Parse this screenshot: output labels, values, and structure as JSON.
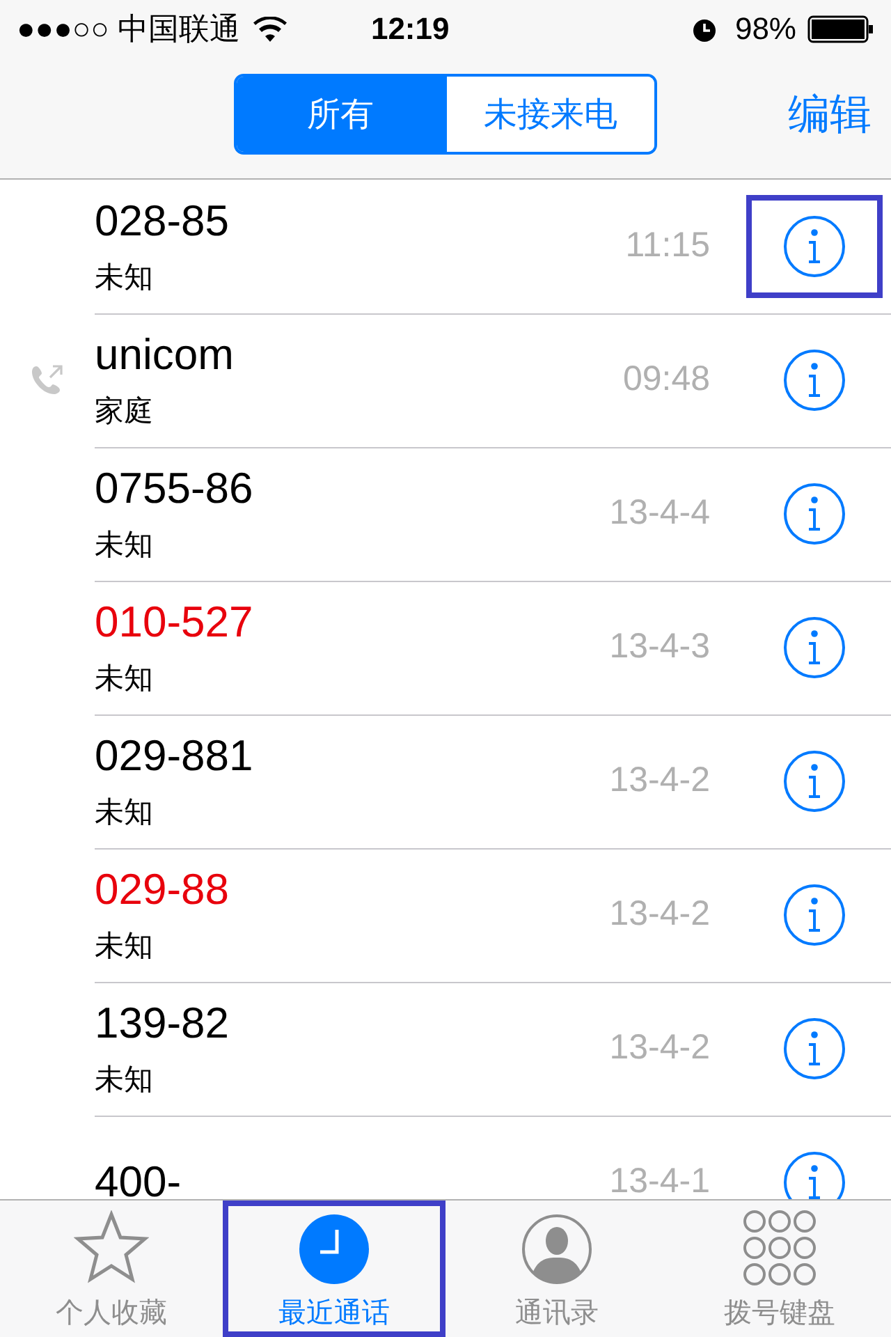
{
  "status_bar": {
    "signal": "●●●○○",
    "carrier": "中国联通",
    "time": "12:19",
    "battery": "98%"
  },
  "nav": {
    "segments": [
      {
        "label": "所有",
        "selected": true
      },
      {
        "label": "未接来电",
        "selected": false
      }
    ],
    "edit": "编辑"
  },
  "calls": [
    {
      "number": "028-85",
      "label": "未知",
      "time": "11:15",
      "missed": false,
      "outgoing": false,
      "highlighted": true
    },
    {
      "number": "unicom",
      "label": "家庭",
      "time": "09:48",
      "missed": false,
      "outgoing": true,
      "highlighted": false
    },
    {
      "number": "0755-86",
      "label": "未知",
      "time": "13-4-4",
      "missed": false,
      "outgoing": false,
      "highlighted": false
    },
    {
      "number": "010-527",
      "label": "未知",
      "time": "13-4-3",
      "missed": true,
      "outgoing": false,
      "highlighted": false
    },
    {
      "number": "029-881",
      "label": "未知",
      "time": "13-4-2",
      "missed": false,
      "outgoing": false,
      "highlighted": false
    },
    {
      "number": "029-88",
      "label": "未知",
      "time": "13-4-2",
      "missed": true,
      "outgoing": false,
      "highlighted": false
    },
    {
      "number": "139-82",
      "label": "未知",
      "time": "13-4-2",
      "missed": false,
      "outgoing": false,
      "highlighted": false
    },
    {
      "number": "400-",
      "time": "13-4-1",
      "missed": false,
      "outgoing": false,
      "highlighted": false
    }
  ],
  "tabs": [
    {
      "kind": "favorites",
      "label": "个人收藏",
      "selected": false,
      "highlighted": false
    },
    {
      "kind": "recents",
      "label": "最近通话",
      "selected": true,
      "highlighted": true
    },
    {
      "kind": "contacts",
      "label": "通讯录",
      "selected": false,
      "highlighted": false
    },
    {
      "kind": "keypad",
      "label": "拨号键盘",
      "selected": false,
      "highlighted": false
    }
  ]
}
